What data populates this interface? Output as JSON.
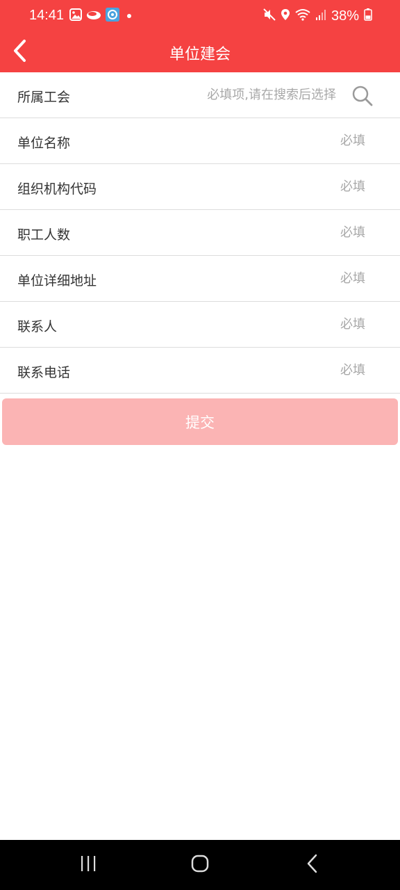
{
  "status_bar": {
    "time": "14:41",
    "battery_percent": "38%",
    "battery_level": 0.38,
    "left_icons": [
      "gallery-icon",
      "app-notification-icon",
      "app-badge-icon",
      "dot-icon"
    ],
    "right_icons": [
      "mute-icon",
      "location-icon",
      "wifi-icon",
      "signal-icon",
      "battery-icon"
    ]
  },
  "header": {
    "title": "单位建会",
    "back_icon": "chevron-left-icon",
    "background_color": "#f54242"
  },
  "form": {
    "rows": [
      {
        "label": "所属工会",
        "placeholder": "必填项,请在搜索后选择",
        "value": "",
        "has_search": true
      },
      {
        "label": "单位名称",
        "placeholder": "必填",
        "value": ""
      },
      {
        "label": "组织机构代码",
        "placeholder": "必填",
        "value": ""
      },
      {
        "label": "职工人数",
        "placeholder": "必填",
        "value": ""
      },
      {
        "label": "单位详细地址",
        "placeholder": "必填",
        "value": ""
      },
      {
        "label": "联系人",
        "placeholder": "必填",
        "value": ""
      },
      {
        "label": "联系电话",
        "placeholder": "必填",
        "value": ""
      }
    ],
    "submit_label": "提交",
    "submit_color": "#fbb4b4"
  },
  "nav_bar": {
    "buttons": [
      "recent-apps-icon",
      "home-icon",
      "back-icon"
    ]
  }
}
